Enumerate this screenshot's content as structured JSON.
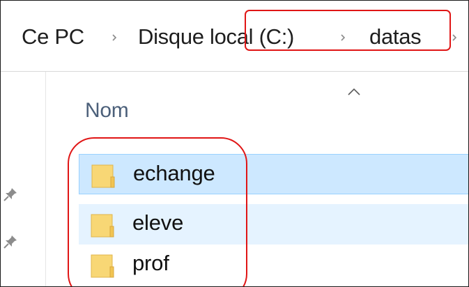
{
  "breadcrumb": {
    "items": [
      {
        "label": "Ce PC"
      },
      {
        "label": "Disque local (C:)"
      },
      {
        "label": "datas"
      }
    ]
  },
  "columns": {
    "name_header": "Nom",
    "sort": "ascending"
  },
  "files": [
    {
      "name": "echange",
      "type": "folder",
      "state": "selected"
    },
    {
      "name": "eleve",
      "type": "folder",
      "state": "hover"
    },
    {
      "name": "prof",
      "type": "folder",
      "state": "normal"
    }
  ],
  "icons": {
    "breadcrumb_separator": "chevron-right-icon",
    "sort_indicator": "chevron-up-icon",
    "quick_access_pin": "pin-icon",
    "file_icon": "folder-icon"
  },
  "colors": {
    "annotation": "#e01515",
    "selected_row": "#cde8ff",
    "selected_border": "#99d1ff",
    "hover_row": "#e5f3ff",
    "column_header_text": "#4c607a",
    "folder_fill": "#f8d775"
  }
}
